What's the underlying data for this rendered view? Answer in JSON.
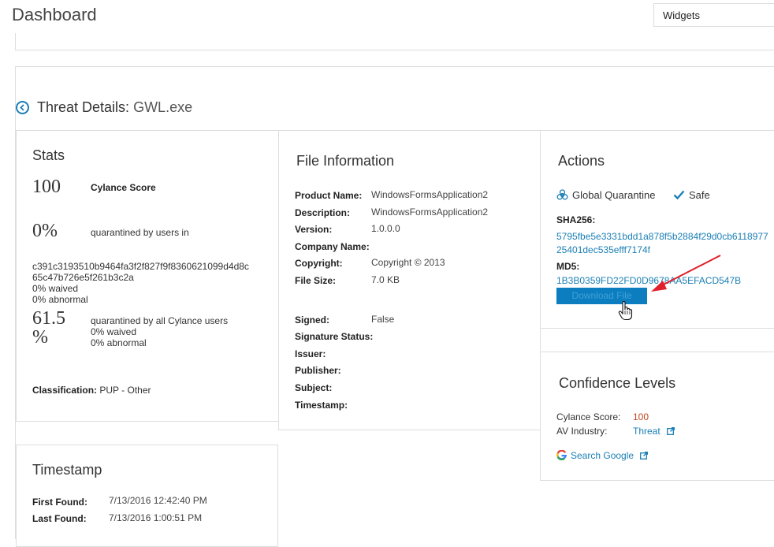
{
  "header": {
    "title": "Dashboard",
    "widgets_label": "Widgets"
  },
  "threat": {
    "title_label": "Threat Details:",
    "file_name": "GWL.exe"
  },
  "stats": {
    "title": "Stats",
    "score": "100",
    "score_label": "Cylance Score",
    "quarantine_pct": "0%",
    "quarantine_label": "quarantined by users in",
    "hash_line1": "c391c3193510b9464fa3f2f827f9f8360621099d4d8c",
    "hash_line2": "65c47b726e5f261b3c2a",
    "waived": "0% waived",
    "abnormal": "0% abnormal",
    "all_pct_line1": "61.5",
    "all_pct_line2": "%",
    "all_label": "quarantined by all Cylance users",
    "all_waived": "0% waived",
    "all_abnormal": "0% abnormal",
    "classification_label": "Classification:",
    "classification_value": "PUP - Other"
  },
  "file_info": {
    "title": "File Information",
    "product_name_label": "Product Name:",
    "product_name": "WindowsFormsApplication2",
    "description_label": "Description:",
    "description": "WindowsFormsApplication2",
    "version_label": "Version:",
    "version": "1.0.0.0",
    "company_label": "Company Name:",
    "copyright_label": "Copyright:",
    "copyright": "Copyright © 2013",
    "file_size_label": "File Size:",
    "file_size": "7.0 KB",
    "signed_label": "Signed:",
    "signed": "False",
    "sig_status_label": "Signature Status:",
    "issuer_label": "Issuer:",
    "publisher_label": "Publisher:",
    "subject_label": "Subject:",
    "timestamp_label": "Timestamp:"
  },
  "actions": {
    "title": "Actions",
    "global_quarantine": "Global Quarantine",
    "safe": "Safe",
    "sha256_label": "SHA256:",
    "sha256_line1": "5795fbe5e3331bdd1a878f5b2884f29d0cb6118977",
    "sha256_line2": "25401dec535efff7174f",
    "md5_label": "MD5:",
    "md5": "1B3B0359FD22FD0D9678AA5EFACD547B",
    "download_label": "Download File"
  },
  "confidence": {
    "title": "Confidence Levels",
    "cylance_label": "Cylance Score:",
    "cylance_value": "100",
    "av_label": "AV Industry:",
    "av_value": "Threat",
    "google_label": "Search Google"
  },
  "timestamp": {
    "title": "Timestamp",
    "first_label": "First Found:",
    "first_value": "7/13/2016 12:42:40 PM",
    "last_label": "Last Found:",
    "last_value": "7/13/2016 1:00:51 PM"
  },
  "colors": {
    "link": "#1a7fb5",
    "score_red": "#c4451c",
    "button": "#0c7ec0",
    "arrow": "#e0202a"
  }
}
